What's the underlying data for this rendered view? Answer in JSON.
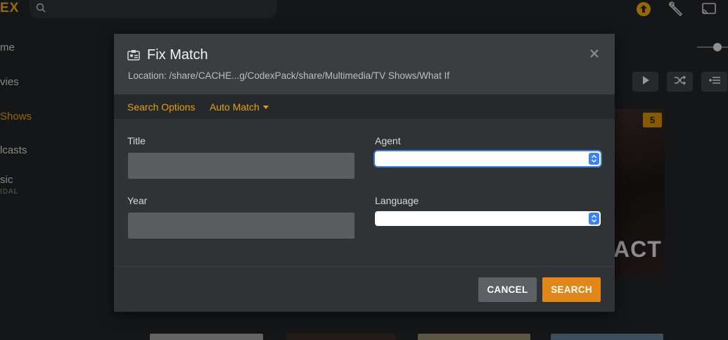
{
  "app": {
    "logo_text": "EX"
  },
  "sidebar": {
    "items": [
      {
        "label": "me"
      },
      {
        "label": "vies"
      },
      {
        "label": "Shows"
      },
      {
        "label": "lcasts"
      },
      {
        "label": "sic",
        "sub": "IDAL"
      }
    ]
  },
  "poster": {
    "badge": "5",
    "title_text": "ACT"
  },
  "dialog": {
    "title": "Fix Match",
    "location": "Location: /share/CACHE...g/CodexPack/share/Multimedia/TV Shows/What If",
    "tabs": {
      "search_options": "Search Options",
      "auto_match": "Auto Match"
    },
    "fields": {
      "title_label": "Title",
      "title_value": "",
      "year_label": "Year",
      "year_value": "",
      "agent_label": "Agent",
      "agent_value": "",
      "language_label": "Language",
      "language_value": ""
    },
    "buttons": {
      "cancel": "CANCEL",
      "search": "SEARCH"
    }
  },
  "colors": {
    "accent": "#e5a00d",
    "search_button": "#e1871a",
    "cancel_button": "#5d6165",
    "select_arrow": "#3b82f0"
  },
  "icons": [
    "search-icon",
    "upload-icon",
    "wrench-icon",
    "cast-icon",
    "play-icon",
    "shuffle-icon",
    "add-to-list-icon",
    "id-card-icon",
    "close-icon",
    "caret-down-icon",
    "select-arrows-icon"
  ]
}
